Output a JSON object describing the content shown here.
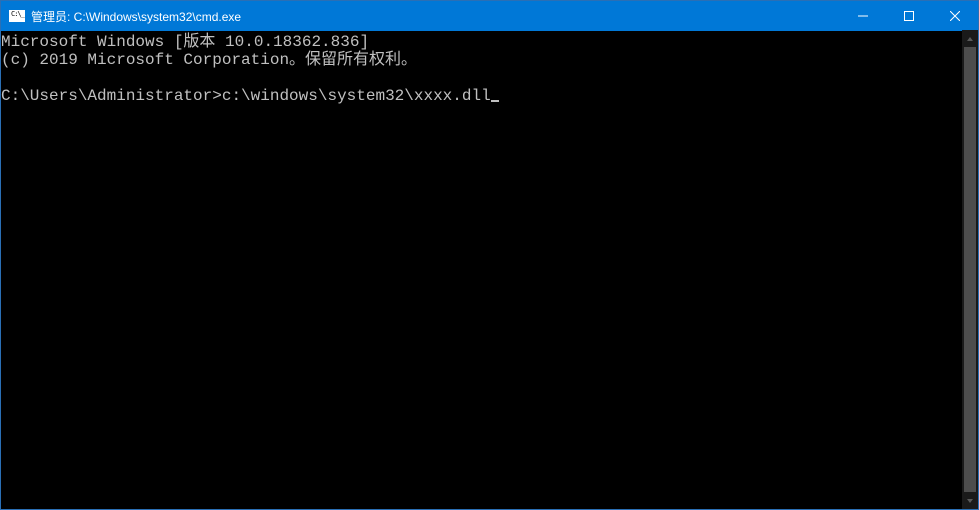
{
  "titlebar": {
    "title": "管理员: C:\\Windows\\system32\\cmd.exe"
  },
  "terminal": {
    "line1": "Microsoft Windows [版本 10.0.18362.836]",
    "line2": "(c) 2019 Microsoft Corporation。保留所有权利。",
    "blank": "",
    "prompt": "C:\\Users\\Administrator>",
    "input": "c:\\windows\\system32\\xxxx.dll"
  },
  "colors": {
    "titlebar_bg": "#0078d7",
    "terminal_bg": "#000000",
    "terminal_fg": "#c0c0c0"
  }
}
